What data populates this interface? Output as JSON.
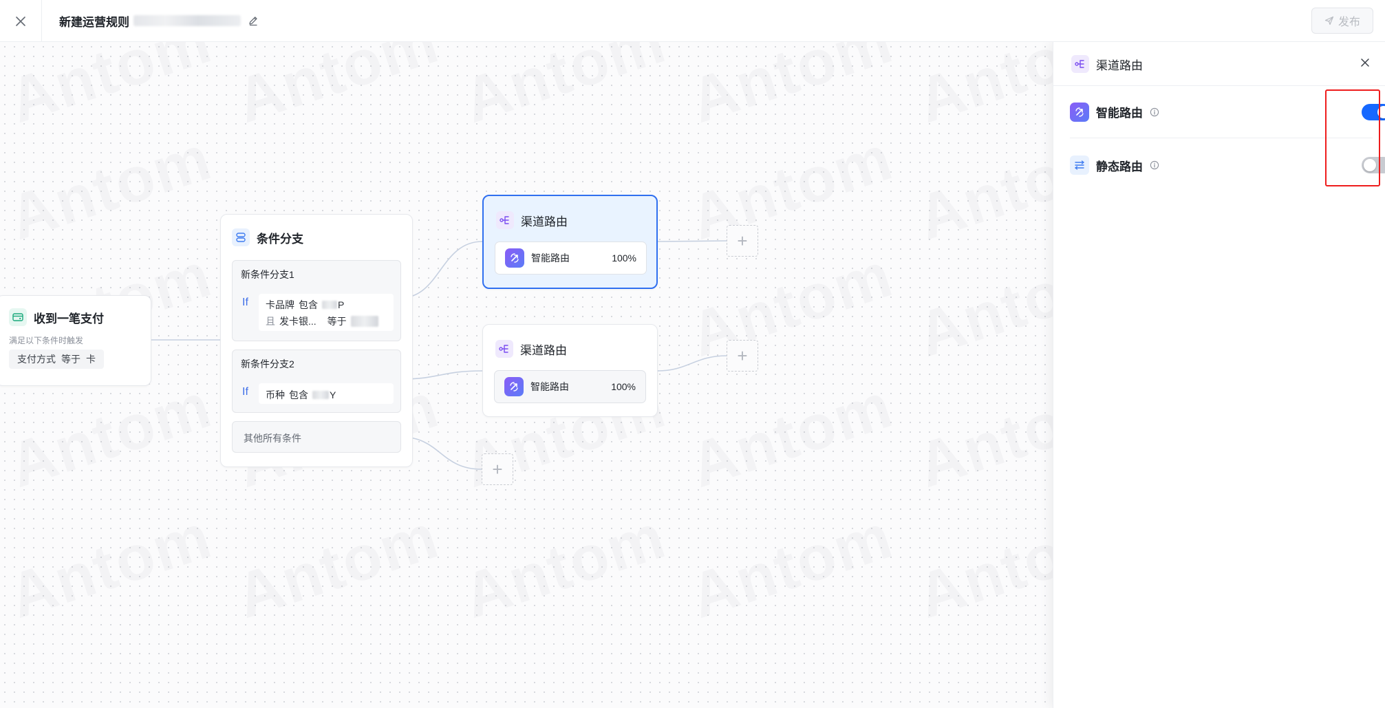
{
  "topbar": {
    "title": "新建运营规则",
    "publish_label": "发布"
  },
  "canvas": {
    "watermark_text": "Antom",
    "trigger": {
      "title": "收到一笔支付",
      "subtitle": "满足以下条件时触发",
      "condition_field": "支付方式",
      "condition_op": "等于",
      "condition_value": "卡"
    },
    "condition_node": {
      "title": "条件分支",
      "if_label": "If",
      "branches": [
        {
          "name": "新条件分支1",
          "rules": [
            {
              "field": "卡品牌",
              "op": "包含",
              "value_suffix": "P"
            },
            {
              "connector": "且",
              "field": "发卡银...",
              "op": "等于"
            }
          ]
        },
        {
          "name": "新条件分支2",
          "rules": [
            {
              "field": "币种",
              "op": "包含",
              "value_suffix": "Y"
            }
          ]
        }
      ],
      "other_label": "其他所有条件"
    },
    "routes": [
      {
        "title": "渠道路由",
        "strategy": "智能路由",
        "percent": "100%"
      },
      {
        "title": "渠道路由",
        "strategy": "智能路由",
        "percent": "100%"
      }
    ],
    "add_symbol": "+"
  },
  "panel": {
    "title": "渠道路由",
    "options": [
      {
        "label": "智能路由",
        "enabled": true
      },
      {
        "label": "静态路由",
        "enabled": false
      }
    ]
  },
  "colors": {
    "accent": "#1668ff",
    "route_active_bg": "#e9f3ff",
    "route_active_border": "#2f6ff0",
    "highlight": "#ee1c1c",
    "smart_route_gradient": [
      "#8a5cf6",
      "#5b7cf7"
    ]
  },
  "icons": {
    "close": "close-icon",
    "edit": "edit-icon",
    "publish": "send-icon",
    "trigger": "card-icon",
    "condition": "branch-icon",
    "route": "route-icon",
    "smart_route": "smart-route-icon",
    "static_route": "static-route-icon",
    "info": "info-icon"
  }
}
